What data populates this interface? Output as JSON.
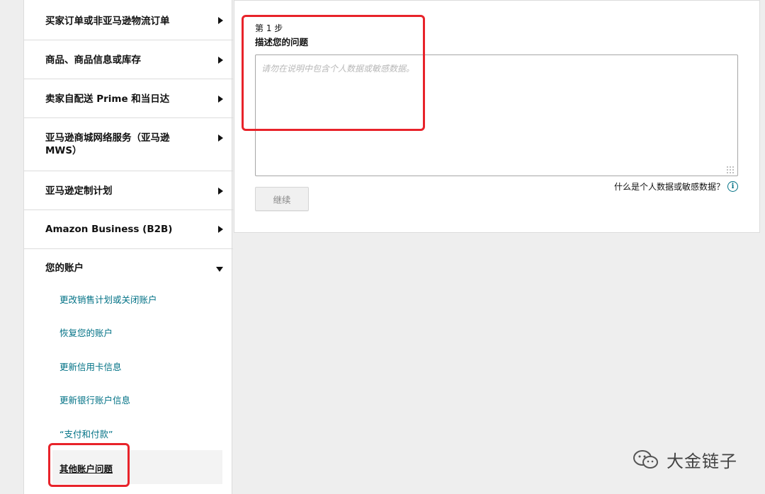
{
  "sidebar": {
    "categories": [
      {
        "label": "买家订单或非亚马逊物流订单"
      },
      {
        "label": "商品、商品信息或库存"
      },
      {
        "label": "卖家自配送 Prime 和当日达"
      },
      {
        "label": "亚马逊商城网络服务（亚马逊 MWS）"
      },
      {
        "label": "亚马逊定制计划"
      },
      {
        "label": "Amazon Business (B2B)"
      },
      {
        "label": "您的账户"
      }
    ],
    "sub_items": [
      {
        "label": "更改销售计划或关闭账户"
      },
      {
        "label": "恢复您的账户"
      },
      {
        "label": "更新信用卡信息"
      },
      {
        "label": "更新银行账户信息"
      },
      {
        "label": "“支付和付款”"
      },
      {
        "label": "其他账户问题"
      }
    ]
  },
  "form": {
    "step_number": "第 1 步",
    "step_title": "描述您的问题",
    "textarea_placeholder": "请勿在说明中包含个人数据或敏感数据。",
    "textarea_value": "",
    "help_text": "什么是个人数据或敏感数据？",
    "continue_label": "继续"
  },
  "watermark": {
    "text": "大金链子"
  },
  "colors": {
    "link": "#007185",
    "highlight": "#e8232a",
    "panel_bg": "#ffffff",
    "page_bg": "#eeeeee"
  }
}
